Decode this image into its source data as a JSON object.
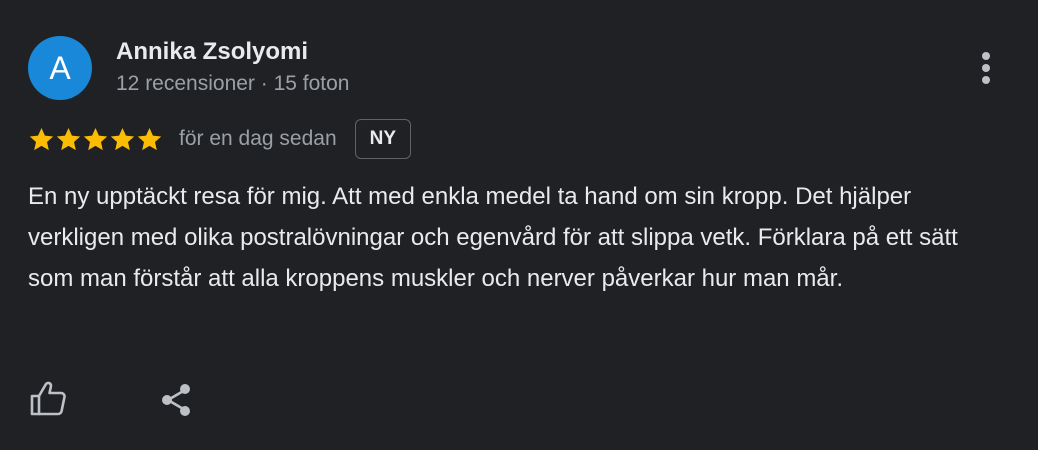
{
  "author": {
    "avatar_letter": "A",
    "avatar_color": "#1a88d8",
    "name": "Annika Zsolyomi",
    "meta": "12 recensioner · 15 foton"
  },
  "review": {
    "rating": 5,
    "max_rating": 5,
    "star_color": "#fbbc04",
    "date": "för en dag sedan",
    "badge": "NY",
    "text": "En ny upptäckt resa för mig. Att med enkla medel ta hand om sin kropp. Det hjälper verkligen med olika postralövningar och egenvård för att slippa vetk. Förklara på ett sätt som man förstår att alla kroppens muskler och nerver påverkar hur man mår."
  },
  "icons": {
    "more": "more-vert-icon",
    "like": "thumb-up-icon",
    "share": "share-icon",
    "star": "star-icon"
  }
}
